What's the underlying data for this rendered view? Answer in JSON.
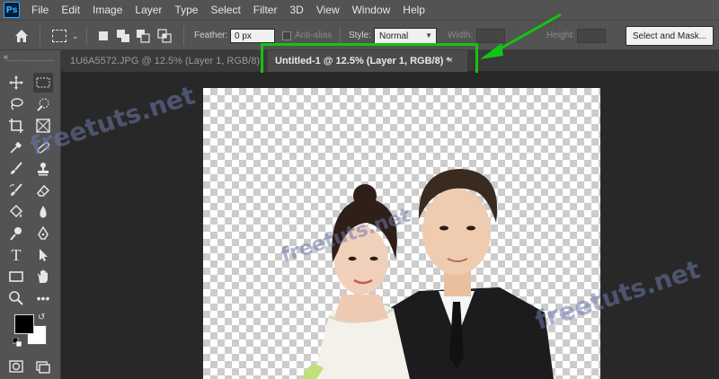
{
  "app": {
    "logo_text": "Ps"
  },
  "menu": [
    "File",
    "Edit",
    "Image",
    "Layer",
    "Type",
    "Select",
    "Filter",
    "3D",
    "View",
    "Window",
    "Help"
  ],
  "options": {
    "feather_label": "Feather:",
    "feather_value": "0 px",
    "antialias_label": "Anti-alias",
    "style_label": "Style:",
    "style_value": "Normal",
    "width_label": "Width:",
    "height_label": "Height:",
    "select_mask_label": "Select and Mask..."
  },
  "tabs": [
    {
      "label": "1U6A5572.JPG @ 12.5% (Layer 1, RGB/8) *",
      "active": false
    },
    {
      "label": "Untitled-1 @ 12.5% (Layer 1, RGB/8) *",
      "active": true
    }
  ],
  "toolbar": {
    "collapse": "«",
    "tools": [
      "move-tool",
      "marquee-tool",
      "lasso-tool",
      "quick-selection-tool",
      "crop-tool",
      "frame-tool",
      "eyedropper-tool",
      "healing-brush-tool",
      "brush-tool",
      "clone-stamp-tool",
      "history-brush-tool",
      "eraser-tool",
      "paint-bucket-tool",
      "blur-tool",
      "dodge-tool",
      "pen-tool",
      "type-tool",
      "path-selection-tool",
      "rectangle-tool",
      "hand-tool",
      "zoom-tool",
      "more-tools"
    ],
    "foreground_color": "#000000",
    "background_color": "#ffffff"
  },
  "watermarks": [
    "freetuts.net",
    "freetuts.net",
    "freetuts.net"
  ],
  "colors": {
    "highlight": "#12c512",
    "panel": "#535353",
    "workspace": "#282828"
  }
}
